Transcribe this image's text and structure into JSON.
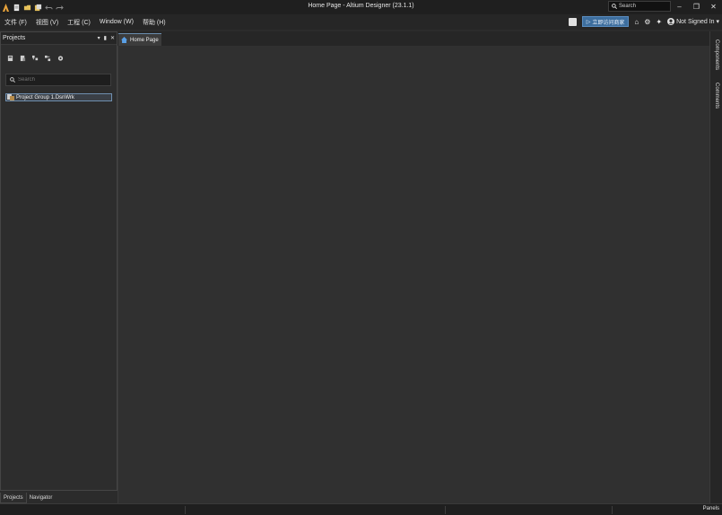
{
  "window": {
    "title": "Home Page - Altium Designer (23.1.1)",
    "search_placeholder": "Search",
    "minimize": "–",
    "maximize": "❐",
    "close": "✕"
  },
  "menu": {
    "items": [
      "文件 (F)",
      "视图 (V)",
      "工程 (C)",
      "Window (W)",
      "帮助 (H)"
    ],
    "promo_label": "立即访问商家",
    "signin_label": "Not Signed In ▾"
  },
  "projects_panel": {
    "title": "Projects",
    "header_buttons": [
      "▾",
      "▮",
      "✕"
    ],
    "search_placeholder": "Search",
    "tree": [
      {
        "label": "Project Group 1.DsnWrk"
      }
    ],
    "bottom_tabs": [
      "Projects",
      "Navigator"
    ]
  },
  "document": {
    "tabs": [
      {
        "label": "Home Page"
      }
    ]
  },
  "side_panels": [
    "Components",
    "Comments"
  ],
  "statusbar": {
    "panels_label": "Panels"
  },
  "colors": {
    "accent": "#3d6e9e",
    "background": "#303030",
    "panel": "#2d2d2d"
  }
}
